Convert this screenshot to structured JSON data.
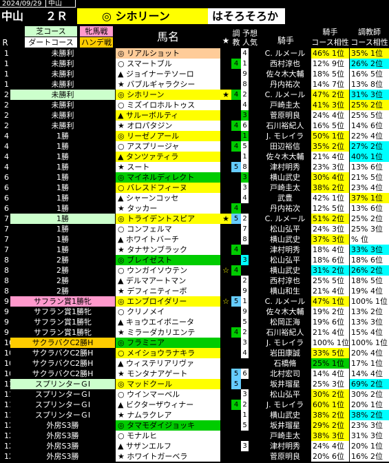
{
  "topbar": {
    "date": "2024/09/29",
    "venue_small": "中山"
  },
  "title": {
    "venue": "中山",
    "race": "２Ｒ",
    "featured": "◎ シホリーン",
    "verdict": "はそろそろか"
  },
  "header": {
    "r": "R",
    "cond_top": "芝コース",
    "cond_bottom": "ダートコース",
    "cond_right_top": "牝馬戦",
    "cond_right_bottom": "ハンデ戦",
    "horse": "馬名",
    "star": "★",
    "weight": "調\n教",
    "pop": "予想\n人気",
    "jockey": "騎手",
    "jc_top": "騎手",
    "jc_bottom": "コース相性",
    "tc_top": "調教師",
    "tc_bottom": "コース相性"
  },
  "rows": [
    {
      "r": "1",
      "cond": "未勝利",
      "cc": "",
      "horse": "◎ リアルショット",
      "hc": "salmon",
      "star": "",
      "w": "",
      "wc": "",
      "p": "4",
      "pc": "white",
      "sp": "",
      "jockey": "C. ルメール",
      "jc": "46% 1位",
      "jcc": "gold",
      "tc": "35% 1位",
      "tcc": "gold"
    },
    {
      "r": "1",
      "cond": "未勝利",
      "cc": "",
      "horse": "○ スマートブル",
      "hc": "white",
      "star": "",
      "w": "4",
      "wc": "green",
      "p": "1",
      "pc": "white",
      "sp": "",
      "jockey": "西村淳也",
      "jc": "12% 9位",
      "jcc": "white",
      "tc": "26% 2位",
      "tcc": "cyan"
    },
    {
      "r": "1",
      "cond": "未勝利",
      "cc": "",
      "horse": "▲ ジョイナーテソーロ",
      "hc": "white",
      "star": "",
      "w": "",
      "wc": "",
      "p": "9",
      "pc": "white",
      "sp": "",
      "jockey": "佐々木大輔",
      "jc": "18% 5位",
      "jcc": "white",
      "tc": "16% 5位",
      "tcc": "white"
    },
    {
      "r": "1",
      "cond": "未勝利",
      "cc": "",
      "horse": "★ バブルギャラクシー",
      "hc": "white",
      "star": "",
      "w": "",
      "wc": "",
      "p": "8",
      "pc": "white",
      "sp": "",
      "jockey": "丹内祐次",
      "jc": "14% 7位",
      "jcc": "white",
      "tc": "13% 8位",
      "tcc": "white"
    },
    {
      "r": "2",
      "cond": "未勝利",
      "cc": "lg",
      "horse": "◎ シホリーン",
      "hc": "gold",
      "star": "★",
      "w": "4",
      "wc": "green",
      "p": "2",
      "pc": "white",
      "sp": "",
      "jockey": "C. ルメール",
      "jc": "47% 2位",
      "jcc": "gold",
      "tc": "31% 3位",
      "tcc": "cyan"
    },
    {
      "r": "2",
      "cond": "未勝利",
      "cc": "",
      "horse": "○ ミズイロホルトゥス",
      "hc": "white",
      "star": "",
      "w": "",
      "wc": "",
      "p": "4",
      "pc": "white",
      "sp": "",
      "jockey": "戸崎圭太",
      "jc": "41% 3位",
      "jcc": "gold",
      "tc": "25% 2位",
      "tcc": "gold"
    },
    {
      "r": "2",
      "cond": "未勝利",
      "cc": "",
      "horse": "▲ サルーボルティ",
      "hc": "gold",
      "star": "",
      "w": "",
      "wc": "",
      "p": "3",
      "pc": "green",
      "sp": "",
      "jockey": "菅原明良",
      "jc": "24% 4位",
      "jcc": "white",
      "tc": "25% 5位",
      "tcc": "white"
    },
    {
      "r": "2",
      "cond": "未勝利",
      "cc": "",
      "horse": "★ オロパタジン",
      "hc": "white",
      "star": "",
      "w": "4",
      "wc": "green",
      "p": "6",
      "pc": "white",
      "sp": "",
      "jockey": "石川裕紀人",
      "jc": "16% 5位",
      "jcc": "white",
      "tc": "14% 6位",
      "tcc": "white"
    },
    {
      "r": "4",
      "cond": "1勝",
      "cc": "",
      "horse": "◎ リーゼノアール",
      "hc": "gold",
      "star": "",
      "w": "",
      "wc": "",
      "p": "1",
      "pc": "green",
      "sp": "",
      "jockey": "J. モレイラ",
      "jc": "50% 1位",
      "jcc": "gold",
      "tc": "22% 4位",
      "tcc": "white"
    },
    {
      "r": "4",
      "cond": "1勝",
      "cc": "",
      "horse": "○ アスプリージャ",
      "hc": "white",
      "star": "",
      "w": "4",
      "wc": "green",
      "p": "5",
      "pc": "white",
      "sp": "",
      "jockey": "田辺裕信",
      "jc": "35% 2位",
      "jcc": "gold",
      "tc": "27% 2位",
      "tcc": "cyan"
    },
    {
      "r": "4",
      "cond": "1勝",
      "cc": "",
      "horse": "▲ タンツァティラ",
      "hc": "gold",
      "star": "",
      "w": "",
      "wc": "",
      "p": "1",
      "pc": "white",
      "sp": "",
      "jockey": "佐々木大輔",
      "jc": "21% 4位",
      "jcc": "white",
      "tc": "40% 1位",
      "tcc": "cyan"
    },
    {
      "r": "4",
      "cond": "1勝",
      "cc": "",
      "horse": "★ スート",
      "hc": "white",
      "star": "",
      "w": "5",
      "wc": "lblue",
      "p": "8",
      "pc": "white",
      "sp": "",
      "jockey": "津村明秀",
      "jc": "23% 3位",
      "jcc": "white",
      "tc": "13% 6位",
      "tcc": "white"
    },
    {
      "r": "6",
      "cond": "1勝",
      "cc": "",
      "horse": "◎ マイネルディレクト",
      "hc": "green",
      "star": "",
      "w": "",
      "wc": "",
      "p": "3",
      "pc": "green",
      "sp": "",
      "jockey": "横山武史",
      "jc": "30% 4位",
      "jcc": "gold",
      "tc": "21% 5位",
      "tcc": "white"
    },
    {
      "r": "6",
      "cond": "1勝",
      "cc": "",
      "horse": "○ バレスドフィーヌ",
      "hc": "gold",
      "star": "",
      "w": "",
      "wc": "",
      "p": "3",
      "pc": "white",
      "sp": "",
      "jockey": "戸崎圭太",
      "jc": "38% 2位",
      "jcc": "gold",
      "tc": "23% 4位",
      "tcc": "white"
    },
    {
      "r": "6",
      "cond": "1勝",
      "cc": "",
      "horse": "▲ シャーンコッセ",
      "hc": "white",
      "star": "",
      "w": "",
      "wc": "",
      "p": "4",
      "pc": "white",
      "sp": "",
      "jockey": "武豊",
      "jc": "42% 1位",
      "jcc": "white",
      "tc": "37% 1位",
      "tcc": "gold"
    },
    {
      "r": "6",
      "cond": "1勝",
      "cc": "",
      "horse": "★ タッカー",
      "hc": "white",
      "star": "",
      "w": "4",
      "wc": "green",
      "p": "",
      "pc": "",
      "sp": "",
      "jockey": "丹内祐次",
      "jc": "12% 5位",
      "jcc": "white",
      "tc": "13% 6位",
      "tcc": "white"
    },
    {
      "r": "7",
      "cond": "1勝",
      "cc": "lg",
      "horse": "◎ トライデントスピア",
      "hc": "gold",
      "star": "★",
      "w": "5",
      "wc": "lblue",
      "p": "2",
      "pc": "white",
      "sp": "",
      "jockey": "C. ルメール",
      "jc": "51% 2位",
      "jcc": "gold",
      "tc": "25% 2位",
      "tcc": "white"
    },
    {
      "r": "7",
      "cond": "1勝",
      "cc": "",
      "horse": "○ コンフェルマ",
      "hc": "white",
      "star": "",
      "w": "",
      "wc": "",
      "p": "7",
      "pc": "white",
      "sp": "",
      "jockey": "松山弘平",
      "jc": "24% 3位",
      "jcc": "white",
      "tc": "25% 3位",
      "tcc": "white"
    },
    {
      "r": "7",
      "cond": "1勝",
      "cc": "",
      "horse": "▲ ホワイトバーチ",
      "hc": "white",
      "star": "",
      "w": "",
      "wc": "",
      "p": "8",
      "pc": "white",
      "sp": "",
      "jockey": "横山武史",
      "jc": "37% 3位",
      "jcc": "gold",
      "tc": "% 位",
      "tcc": "white"
    },
    {
      "r": "7",
      "cond": "1勝",
      "cc": "",
      "horse": "★ タナサンブラック",
      "hc": "white",
      "star": "",
      "w": "4",
      "wc": "green",
      "p": "",
      "pc": "",
      "sp": "",
      "jockey": "津村明秀",
      "jc": "18% 4位",
      "jcc": "white",
      "tc": "33% 3位",
      "tcc": "cyan"
    },
    {
      "r": "8",
      "cond": "2勝",
      "cc": "",
      "horse": "◎ ブレイゼスト",
      "hc": "green",
      "star": "",
      "w": "",
      "wc": "",
      "p": "3",
      "pc": "cyan",
      "sp": "",
      "jockey": "松山弘平",
      "jc": "18% 6位",
      "jcc": "white",
      "tc": "18% 6位",
      "tcc": "white"
    },
    {
      "r": "8",
      "cond": "2勝",
      "cc": "",
      "horse": "○ ウンガイソウテン",
      "hc": "white",
      "star": "☆",
      "w": "4",
      "wc": "green",
      "p": "",
      "pc": "",
      "sp": "",
      "jockey": "横山武史",
      "jc": "31% 2位",
      "jcc": "cyan",
      "tc": "26% 2位",
      "tcc": "cyan"
    },
    {
      "r": "8",
      "cond": "2勝",
      "cc": "",
      "horse": "▲ デルマアートマン",
      "hc": "white",
      "star": "",
      "w": "",
      "wc": "",
      "p": "2",
      "pc": "white",
      "sp": "",
      "jockey": "西村淳也",
      "jc": "25% 5位",
      "jcc": "white",
      "tc": "18% 5位",
      "tcc": "white"
    },
    {
      "r": "8",
      "cond": "2勝",
      "cc": "",
      "horse": "★ デフィニティーボ",
      "hc": "white",
      "star": "",
      "w": "",
      "wc": "",
      "p": "9",
      "pc": "white",
      "sp": "",
      "jockey": "横山和生",
      "jc": "21% 4位",
      "jcc": "white",
      "tc": "19% 4位",
      "tcc": "white"
    },
    {
      "r": "9",
      "cond": "サフラン賞1勝牝",
      "cc": "pink",
      "horse": "◎ エンブロイダリー",
      "hc": "gold",
      "star": "☆",
      "w": "5",
      "wc": "lblue",
      "p": "1",
      "pc": "white",
      "sp": "",
      "jockey": "C. ルメール",
      "jc": "47% 1位",
      "jcc": "gold",
      "tc": "100% 1位",
      "tcc": "white"
    },
    {
      "r": "9",
      "cond": "サフラン賞1勝牝",
      "cc": "",
      "horse": "○ クリノメイ",
      "hc": "white",
      "star": "",
      "w": "",
      "wc": "",
      "p": "9",
      "pc": "white",
      "sp": "",
      "jockey": "佐々木大輔",
      "jc": "19% 2位",
      "jcc": "white",
      "tc": "13% 2位",
      "tcc": "white"
    },
    {
      "r": "9",
      "cond": "サフラン賞1勝牝",
      "cc": "",
      "horse": "▲ キョウエイボニータ",
      "hc": "white",
      "star": "",
      "w": "",
      "wc": "",
      "p": "5",
      "pc": "white",
      "sp": "",
      "jockey": "松岡正海",
      "jc": "19% 6位",
      "jcc": "white",
      "tc": "13% 3位",
      "tcc": "white"
    },
    {
      "r": "9",
      "cond": "サフラン賞1勝牝",
      "cc": "",
      "horse": "★ ミラーダカリエンテ",
      "hc": "white",
      "star": "",
      "w": "4",
      "wc": "green",
      "p": "2",
      "pc": "white",
      "sp": "",
      "jockey": "石川裕紀人",
      "jc": "21% 4位",
      "jcc": "white",
      "tc": "15% 4位",
      "tcc": "white"
    },
    {
      "r": "10",
      "cond": "サクラバクC2勝H",
      "cc": "orange",
      "horse": "◎ フラミニア",
      "hc": "green",
      "star": "",
      "w": "",
      "wc": "",
      "p": "3",
      "pc": "white",
      "sp": "",
      "jockey": "J. モレイラ",
      "jc": "100% 1位",
      "jcc": "white",
      "tc": "100% 1位",
      "tcc": "white"
    },
    {
      "r": "10",
      "cond": "サクラバクC2勝H",
      "cc": "",
      "horse": "○ メイショウラナキラ",
      "hc": "gold",
      "star": "",
      "w": "",
      "wc": "",
      "p": "4",
      "pc": "white",
      "sp": "",
      "jockey": "岩田康誠",
      "jc": "33% 5位",
      "jcc": "gold",
      "tc": "20% 4位",
      "tcc": "white"
    },
    {
      "r": "10",
      "cond": "サクラバクC2勝H",
      "cc": "",
      "horse": "▲ ウィステリアリヴァ",
      "hc": "white",
      "star": "",
      "w": "",
      "wc": "",
      "p": "",
      "pc": "",
      "sp": "",
      "jockey": "石橋脩",
      "jc": "25% 1位",
      "jcc": "green",
      "tc": "17% 1位",
      "tcc": "white"
    },
    {
      "r": "10",
      "cond": "サクラバクC2勝H",
      "cc": "",
      "horse": "★ モンタナアゲート",
      "hc": "white",
      "star": "",
      "w": "5",
      "wc": "lblue",
      "p": "6",
      "pc": "white",
      "sp": "",
      "jockey": "北村宏司",
      "jc": "14% 4位",
      "jcc": "white",
      "tc": "14% 4位",
      "tcc": "white"
    },
    {
      "r": "11",
      "cond": "スプリンターＧⅠ",
      "cc": "lg",
      "horse": "◎ マッドクール",
      "hc": "gold",
      "star": "",
      "w": "5",
      "wc": "lblue",
      "p": "",
      "pc": "",
      "sp": "",
      "jockey": "坂井瑠星",
      "jc": "25% 3位",
      "jcc": "white",
      "tc": "69% 2位",
      "tcc": "cyan"
    },
    {
      "r": "11",
      "cond": "スプリンターＧⅠ",
      "cc": "",
      "horse": "○ ウインマーベル",
      "hc": "white",
      "star": "",
      "w": "",
      "wc": "",
      "p": "3",
      "pc": "white",
      "sp": "",
      "jockey": "松山弘平",
      "jc": "30% 2位",
      "jcc": "gold",
      "tc": "30% 2位",
      "tcc": "white"
    },
    {
      "r": "11",
      "cond": "スプリンターＧⅠ",
      "cc": "",
      "horse": "▲ ビクターザウィナー",
      "hc": "white",
      "star": "",
      "w": "4",
      "wc": "green",
      "p": "2",
      "pc": "white",
      "sp": "",
      "jockey": "J. モレイラ",
      "jc": "60% 1位",
      "jcc": "gold",
      "tc": "20% 1位",
      "tcc": "white"
    },
    {
      "r": "11",
      "cond": "スプリンターＧⅠ",
      "cc": "",
      "horse": "★ ナムラクレア",
      "hc": "white",
      "star": "",
      "w": "",
      "wc": "",
      "p": "1",
      "pc": "white",
      "sp": "",
      "jockey": "横山武史",
      "jc": "38% 2位",
      "jcc": "gold",
      "tc": "38% 2位",
      "tcc": "cyan"
    },
    {
      "r": "12",
      "cond": "外房S3勝",
      "cc": "",
      "horse": "◎ タマモダイジョッキ",
      "hc": "green",
      "star": "",
      "w": "",
      "wc": "",
      "p": "5",
      "pc": "white",
      "sp": "",
      "jockey": "坂井瑠星",
      "jc": "29% 2位",
      "jcc": "gold",
      "tc": "23% 3位",
      "tcc": "white"
    },
    {
      "r": "12",
      "cond": "外房S3勝",
      "cc": "",
      "horse": "○ モナルヒ",
      "hc": "white",
      "star": "",
      "w": "",
      "wc": "",
      "p": "",
      "pc": "",
      "sp": "",
      "jockey": "戸崎圭太",
      "jc": "38% 3位",
      "jcc": "gold",
      "tc": "31% 3位",
      "tcc": "white"
    },
    {
      "r": "12",
      "cond": "外房S3勝",
      "cc": "",
      "horse": "▲ サザンエルフ",
      "hc": "white",
      "star": "",
      "w": "",
      "wc": "",
      "p": "3",
      "pc": "white",
      "sp": "",
      "jockey": "津村明秀",
      "jc": "24% 4位",
      "jcc": "white",
      "tc": "20% 1位",
      "tcc": "white"
    },
    {
      "r": "12",
      "cond": "外房S3勝",
      "cc": "",
      "horse": "★ ホワイトガーベラ",
      "hc": "white",
      "star": "",
      "w": "",
      "wc": "",
      "p": "",
      "pc": "",
      "sp": "",
      "jockey": "菅原明良",
      "jc": "20% 6位",
      "jcc": "white",
      "tc": "16% 2位",
      "tcc": "white"
    }
  ]
}
